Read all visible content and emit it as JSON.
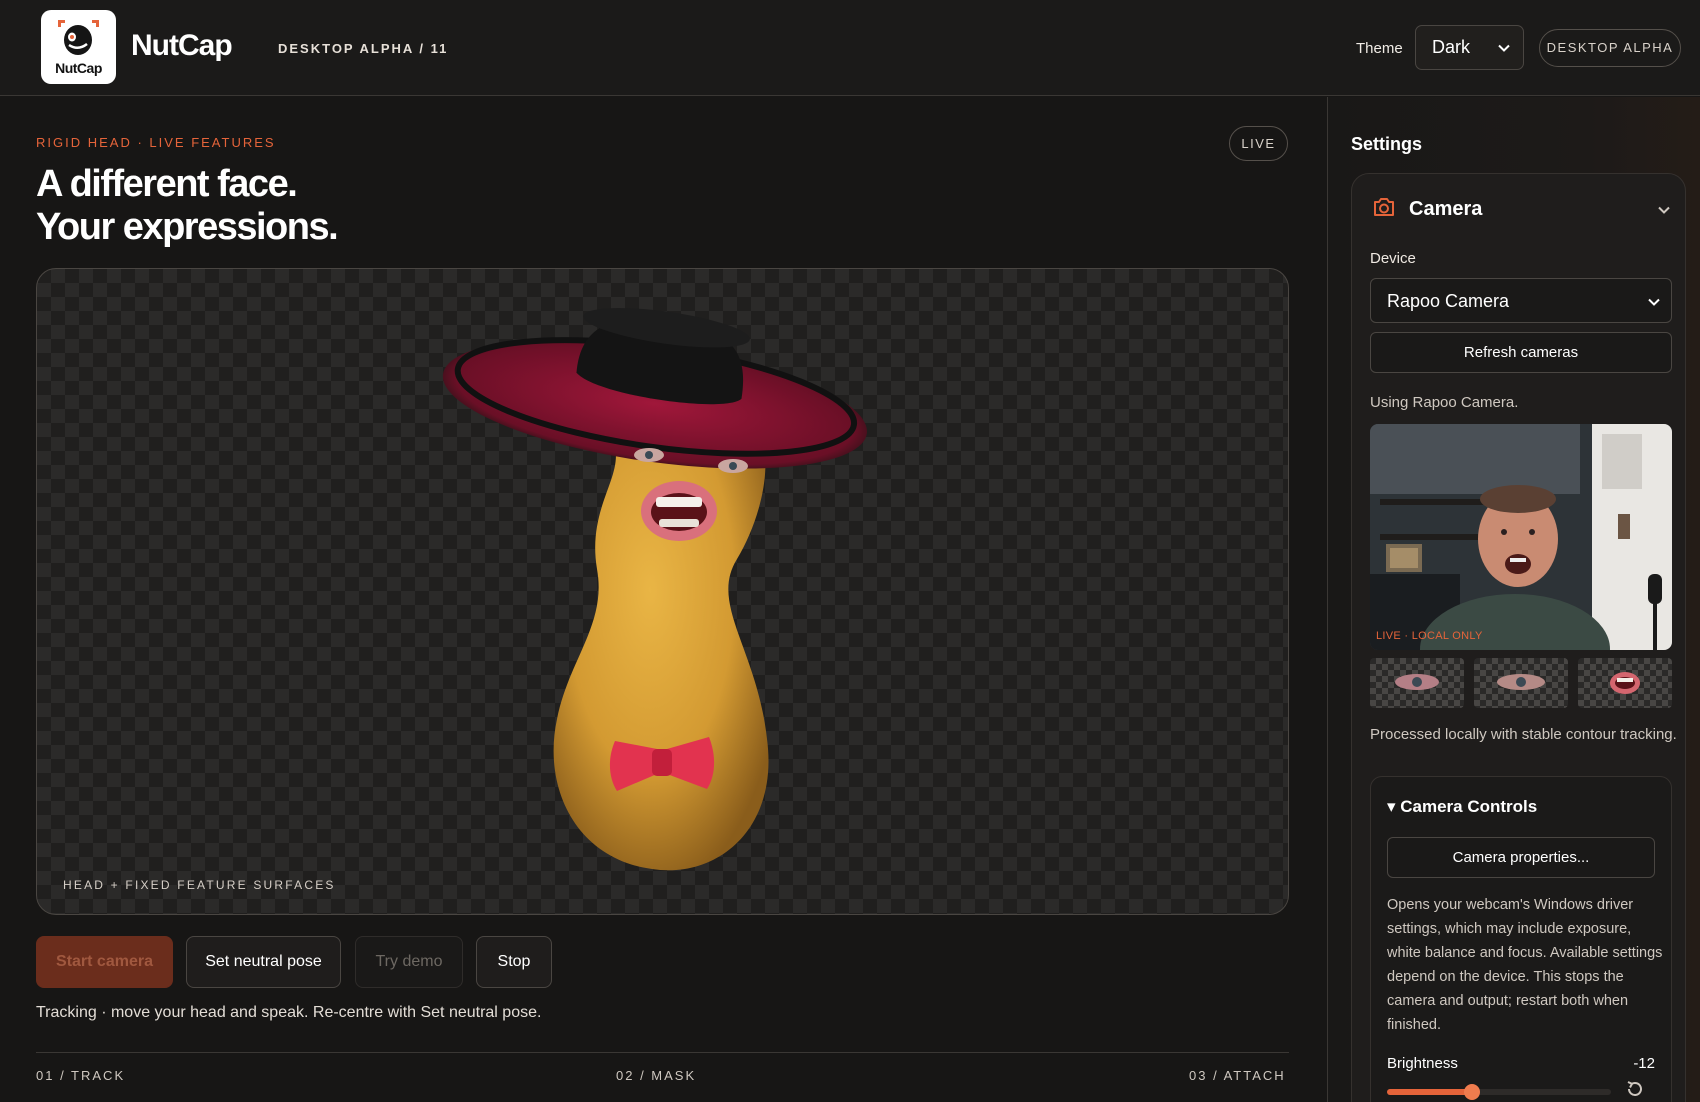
{
  "header": {
    "brand": "NutCap",
    "logo_text": "NutCap",
    "version": "DESKTOP ALPHA / 11",
    "theme_label": "Theme",
    "theme_value": "Dark",
    "badge": "DESKTOP ALPHA"
  },
  "main": {
    "eyebrow": "RIGID HEAD · LIVE FEATURES",
    "live_badge": "LIVE",
    "headline_line1": "A different face.",
    "headline_line2": "Your expressions.",
    "viewport_caption": "HEAD + FIXED FEATURE SURFACES",
    "buttons": {
      "start": "Start camera",
      "neutral": "Set neutral pose",
      "demo": "Try demo",
      "stop": "Stop"
    },
    "status": "Tracking · move your head and speak. Re-centre with Set neutral pose.",
    "steps": [
      "01 / TRACK",
      "02 / MASK",
      "03 / ATTACH"
    ]
  },
  "settings": {
    "title": "Settings",
    "camera": {
      "title": "Camera",
      "device_label": "Device",
      "device_value": "Rapoo Camera",
      "refresh_label": "Refresh cameras",
      "using_text": "Using Rapoo Camera.",
      "preview_badge": "LIVE · LOCAL ONLY",
      "processed_text": "Processed locally with stable contour tracking."
    },
    "controls": {
      "title": "▾ Camera Controls",
      "properties_label": "Camera properties...",
      "description": "Opens your webcam's Windows driver settings, which may include exposure, white balance and focus. Available settings depend on the device. This stops the camera and output; restart both when finished.",
      "brightness_label": "Brightness",
      "brightness_value": "-12",
      "brightness_fraction": 0.38
    }
  },
  "colors": {
    "accent": "#e5643a",
    "background": "#171615",
    "panel": "#1f1d1c"
  }
}
